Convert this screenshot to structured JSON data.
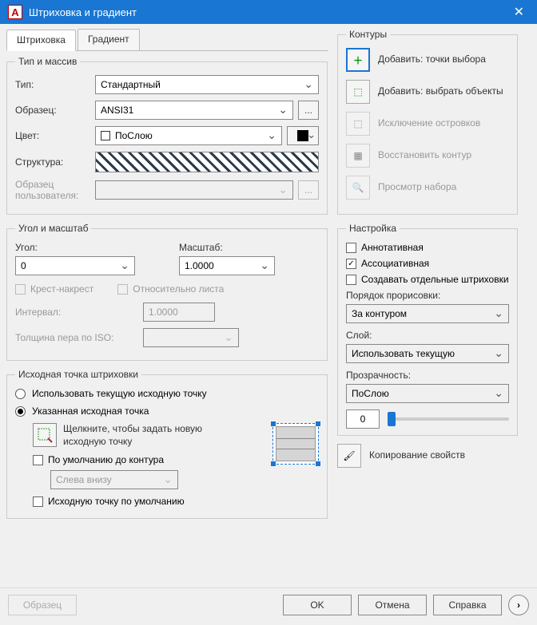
{
  "title": "Штриховка и градиент",
  "tabs": {
    "hatch": "Штриховка",
    "gradient": "Градиент"
  },
  "type_array": {
    "legend": "Тип и массив",
    "type_label": "Тип:",
    "type_value": "Стандартный",
    "pattern_label": "Образец:",
    "pattern_value": "ANSI31",
    "color_label": "Цвет:",
    "color_value": "ПоСлою",
    "swatch_label": "Структура:",
    "custom_label": "Образец пользователя:",
    "browse": "..."
  },
  "angle_scale": {
    "legend": "Угол и масштаб",
    "angle_label": "Угол:",
    "angle_value": "0",
    "scale_label": "Масштаб:",
    "scale_value": "1.0000",
    "double": "Крест-накрест",
    "relative": "Относительно листа",
    "spacing_label": "Интервал:",
    "spacing_value": "1.0000",
    "iso_label": "Толщина пера по ISO:"
  },
  "origin": {
    "legend": "Исходная точка штриховки",
    "use_current": "Использовать текущую исходную точку",
    "specified": "Указанная исходная точка",
    "click_text": "Щелкните, чтобы задать новую исходную точку",
    "default_to_boundary": "По умолчанию до контура",
    "position_value": "Слева внизу",
    "store_default": "Исходную точку по умолчанию"
  },
  "boundaries": {
    "legend": "Контуры",
    "pick_points": "Добавить: точки выбора",
    "select_objects": "Добавить: выбрать объекты",
    "remove": "Исключение островков",
    "recreate": "Восстановить контур",
    "view": "Просмотр набора"
  },
  "options": {
    "legend": "Настройка",
    "annotative": "Аннотативная",
    "associative": "Ассоциативная",
    "separate": "Создавать отдельные штриховки",
    "draw_order_label": "Порядок прорисовки:",
    "draw_order_value": "За контуром",
    "layer_label": "Слой:",
    "layer_value": "Использовать текущую",
    "transparency_label": "Прозрачность:",
    "transparency_value": "ПоСлою",
    "transparency_num": "0"
  },
  "inherit": "Копирование свойств",
  "footer": {
    "preview": "Образец",
    "ok": "OK",
    "cancel": "Отмена",
    "help": "Справка"
  }
}
